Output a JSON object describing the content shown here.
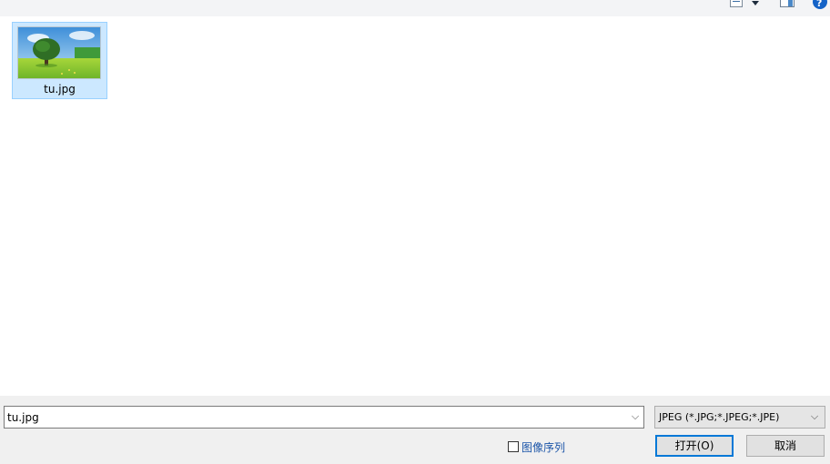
{
  "toolbar": {
    "view_icon": "view-mode-icon",
    "pane_icon": "preview-pane-icon",
    "help_icon": "help-icon"
  },
  "files": [
    {
      "name": "tu.jpg",
      "thumbnail": "tree-landscape-thumbnail",
      "selected": true
    }
  ],
  "bottom": {
    "file_name_value": "tu.jpg",
    "file_type_value": "JPEG (*.JPG;*.JPEG;*.JPE)",
    "image_sequence_label": "图像序列",
    "image_sequence_checked": false,
    "open_label": "打开(O)",
    "cancel_label": "取消"
  },
  "colors": {
    "selection_bg": "#cce8ff",
    "selection_border": "#99d1ff",
    "accent": "#0078d7",
    "link": "#1b55a8"
  }
}
